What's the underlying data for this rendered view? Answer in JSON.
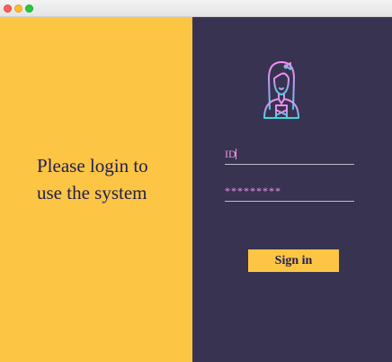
{
  "left": {
    "headline_line1": "Please login to",
    "headline_line2": "use the system"
  },
  "login": {
    "avatar_icon": "woman-avatar-icon",
    "id_placeholder": "ID",
    "password_value": "*********",
    "signin_label": "Sign in"
  },
  "colors": {
    "left_bg": "#fdc544",
    "right_bg": "#373350",
    "text_dark": "#1e1e52",
    "input_text": "#f195e6",
    "avatar_gradient_top": "#f48cf0",
    "avatar_gradient_bottom": "#3fd7e0"
  }
}
